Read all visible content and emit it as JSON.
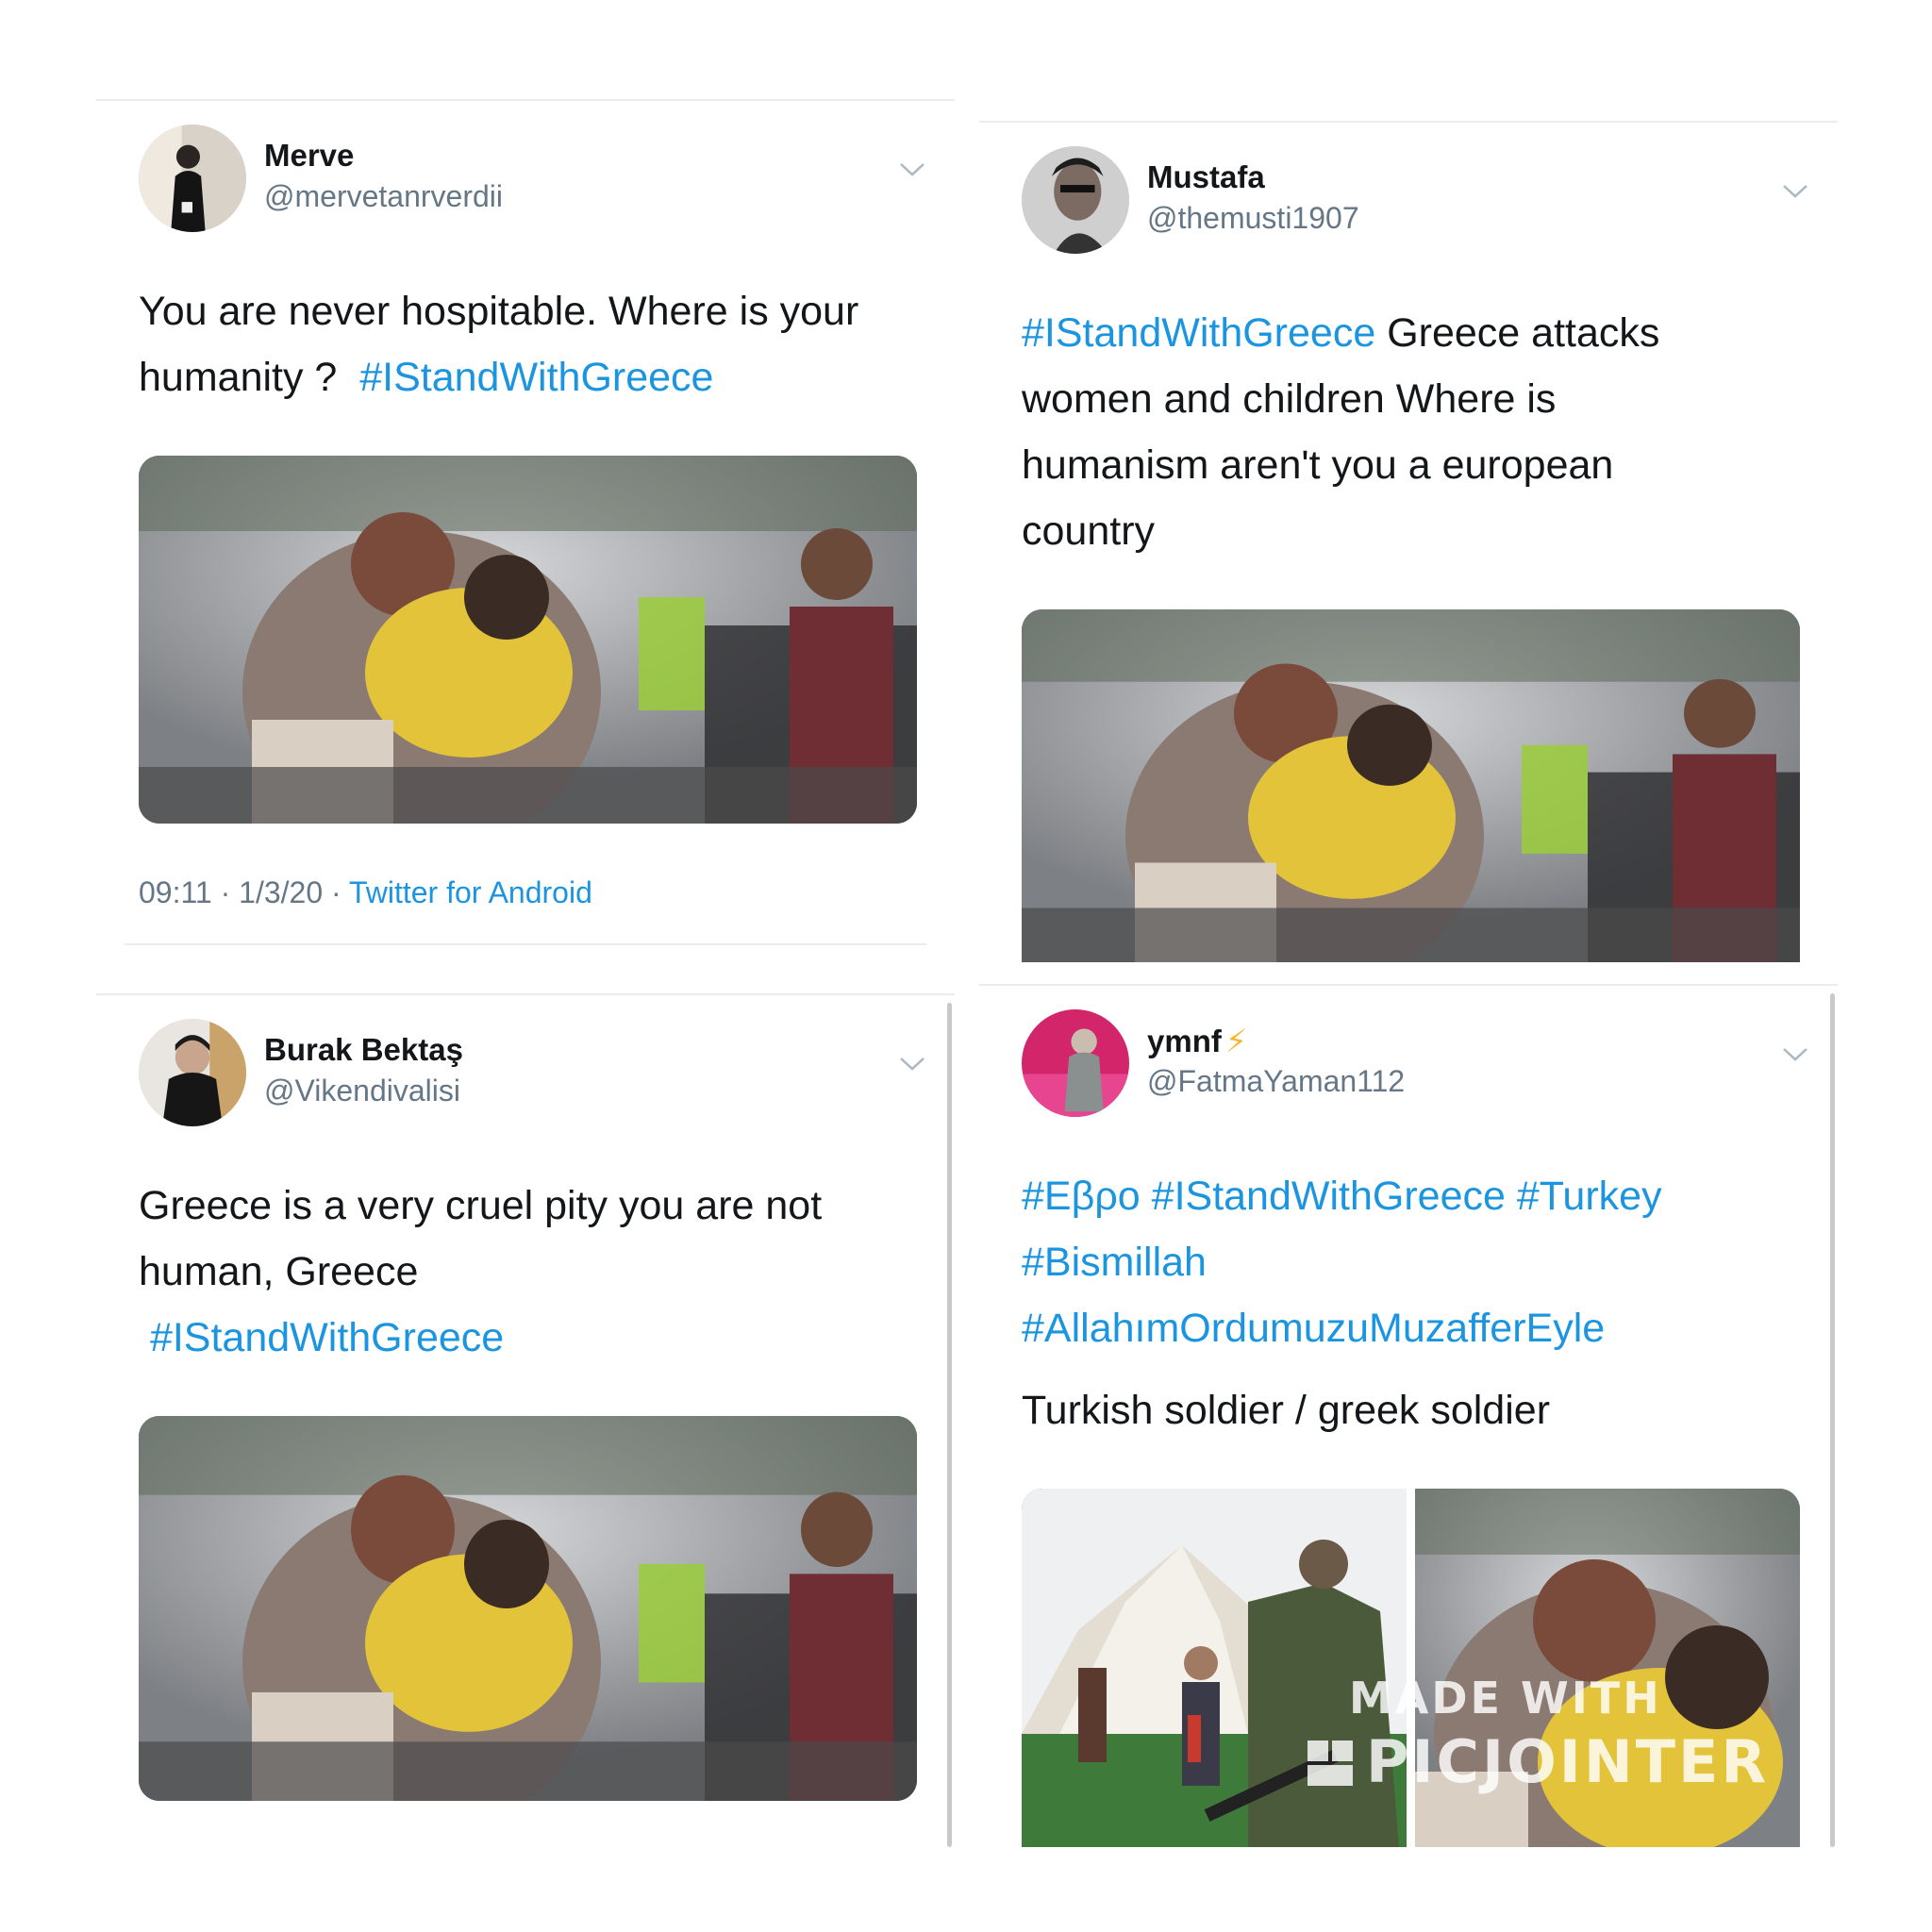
{
  "tweets": [
    {
      "name": "Merve",
      "handle": "@mervetanrverdii",
      "text_lines": [
        [
          {
            "t": "You are never hospitable. Where is your",
            "tag": false
          }
        ],
        [
          {
            "t": "humanity ?  ",
            "tag": false
          },
          {
            "t": "#IStandWithGreece",
            "tag": true
          }
        ]
      ],
      "time": "09:11 · 1/3/20 · ",
      "source": "Twitter for Android",
      "images": 1
    },
    {
      "name": "Mustafa",
      "handle": "@themusti1907",
      "text_lines": [
        [
          {
            "t": "#IStandWithGreece",
            "tag": true
          },
          {
            "t": " Greece attacks",
            "tag": false
          }
        ],
        [
          {
            "t": "women and children Where is",
            "tag": false
          }
        ],
        [
          {
            "t": "humanism aren't you a european",
            "tag": false
          }
        ],
        [
          {
            "t": "country",
            "tag": false
          }
        ]
      ],
      "images": 1
    },
    {
      "name": "Burak Bektaş",
      "handle": "@Vikendivalisi",
      "text_lines": [
        [
          {
            "t": "Greece is a very cruel pity you are not",
            "tag": false
          }
        ],
        [
          {
            "t": "human, Greece",
            "tag": false
          }
        ],
        [
          {
            "t": " #IStandWithGreece",
            "tag": true
          }
        ]
      ],
      "images": 1
    },
    {
      "name": "ymnf",
      "name_badge": "⚡",
      "handle": "@FatmaYaman112",
      "text_lines": [
        [
          {
            "t": "#Εβρο #IStandWithGreece #Turkey",
            "tag": true
          }
        ],
        [
          {
            "t": "#Bismillah",
            "tag": true
          }
        ],
        [
          {
            "t": "#AllahımOrdumuzuMuzafferEyle",
            "tag": true
          }
        ],
        [
          {
            "t": "Turkish soldier / greek soldier",
            "tag": false
          }
        ]
      ],
      "images": 2
    }
  ],
  "watermark": {
    "line1": "MADE WITH",
    "line2": "PICJOINTER"
  },
  "icons": {
    "menu": "chevron-down-icon",
    "verified_badge": "lightning-icon"
  },
  "colors": {
    "link": "#1b95e0",
    "text": "#14171a",
    "muted": "#657786",
    "divider": "#e6ecf0",
    "bolt": "#f5b82e"
  }
}
